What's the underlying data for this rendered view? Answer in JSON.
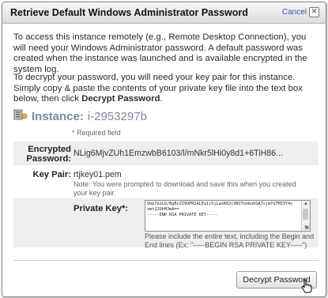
{
  "dialog": {
    "title": "Retrieve Default Windows Administrator Password",
    "cancel_label": "Cancel",
    "cancel_icon": "close-icon"
  },
  "intro": {
    "paragraph1": "To access this instance remotely (e.g., Remote Desktop Connection), you will need your Windows Administrator password. A default password was created when the instance was launched and is available encrypted in the system log.",
    "paragraph2_prefix": "To decrypt your password, you will need your key pair for this instance. Simply copy & paste the contents of your private key file into the text box below, then click ",
    "paragraph2_action": "Decrypt Password",
    "paragraph2_suffix": "."
  },
  "instance": {
    "icon": "server-icon",
    "label": "Instance:",
    "id": "i-2953297b"
  },
  "form": {
    "required_note": "* Required field",
    "encrypted_password_label": "Encrypted Password:",
    "encrypted_password_value": "NLig6MjvZUh1EmzwbB6103/l/mNkr5lHi0y8d1+6TiH86...",
    "key_pair_label": "Key Pair:",
    "key_pair_value": "rtjkey01.pem",
    "key_pair_note": "Note: You were prompted to download and save this when you created your key pair.",
    "private_key_label": "Private Key*:",
    "private_key_value": "Vbp7ezLb/BgBcZI9UPRIALEa1i5jLaxK82cSN1TonkuhGA7sjmfGTM33Y4x\nxmt22UhMJmA==\n-----END RSA PRIVATE KEY-----",
    "private_key_help": "Please include the entire text, including the Begin and End lines (Ex: \"-----BEGIN RSA PRIVATE KEY-----\")"
  },
  "footer": {
    "decrypt_button_label": "Decrypt Password"
  },
  "colors": {
    "instance_text": "#7b8b9a",
    "link": "#2a5db0",
    "row_background": "#eeeeee"
  }
}
